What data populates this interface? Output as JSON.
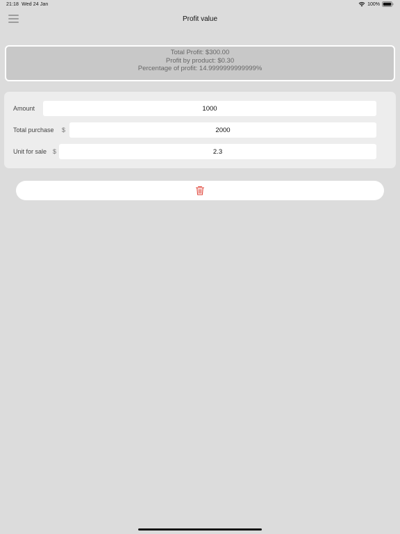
{
  "status_bar": {
    "time": "21:18",
    "date": "Wed 24 Jan",
    "battery": "100%",
    "icons": [
      "wifi-icon",
      "battery-icon"
    ]
  },
  "nav": {
    "title": "Profit value",
    "menu_icon": "hamburger-menu-icon"
  },
  "summary": {
    "total_profit": "Total Profit: $300.00",
    "profit_by_product": "Profit by product: $0.30",
    "percentage": "Percentage of profit: 14.9999999999999%"
  },
  "form": {
    "amount": {
      "label": "Amount",
      "value": "1000"
    },
    "total_purchase": {
      "label": "Total purchase",
      "prefix": "$",
      "value": "2000"
    },
    "unit_for_sale": {
      "label": "Unit for sale",
      "prefix": "$",
      "value": "2.3"
    }
  },
  "clear_button": {
    "icon": "trash-icon",
    "color": "#e0453a"
  },
  "colors": {
    "background": "#dcdcdc",
    "card": "#ededed",
    "summary_card": "#c8c8c8",
    "accent_delete": "#e0453a"
  }
}
